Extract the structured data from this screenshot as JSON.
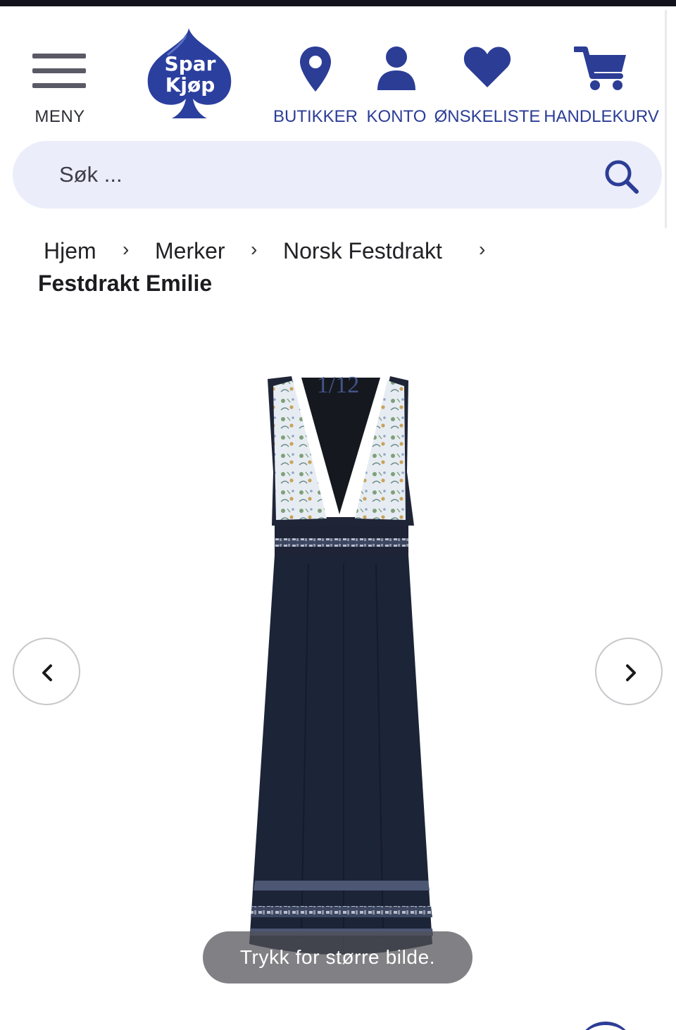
{
  "header": {
    "menu_label": "MENY",
    "logo": {
      "line1": "Spar",
      "line2": "Kjøp",
      "icon": "spade-logo-icon"
    },
    "nav": [
      {
        "label": "BUTIKKER",
        "icon": "map-pin-icon"
      },
      {
        "label": "KONTO",
        "icon": "user-icon"
      },
      {
        "label": "ØNSKELISTE",
        "icon": "heart-icon"
      },
      {
        "label": "HANDLEKURV",
        "icon": "shopping-cart-icon"
      }
    ]
  },
  "search": {
    "placeholder": "Søk ..."
  },
  "breadcrumb": {
    "items": [
      "Hjem",
      "Merker",
      "Norsk Festdrakt"
    ],
    "current": "Festdrakt Emilie"
  },
  "gallery": {
    "counter": "1/12",
    "zoom_hint": "Trykk for større bilde.",
    "prev_icon": "chevron-left-icon",
    "next_icon": "chevron-right-icon"
  },
  "colors": {
    "brand_blue": "#2c3d96",
    "search_bg": "#ecedfa",
    "dress_navy": "#1c2437"
  }
}
